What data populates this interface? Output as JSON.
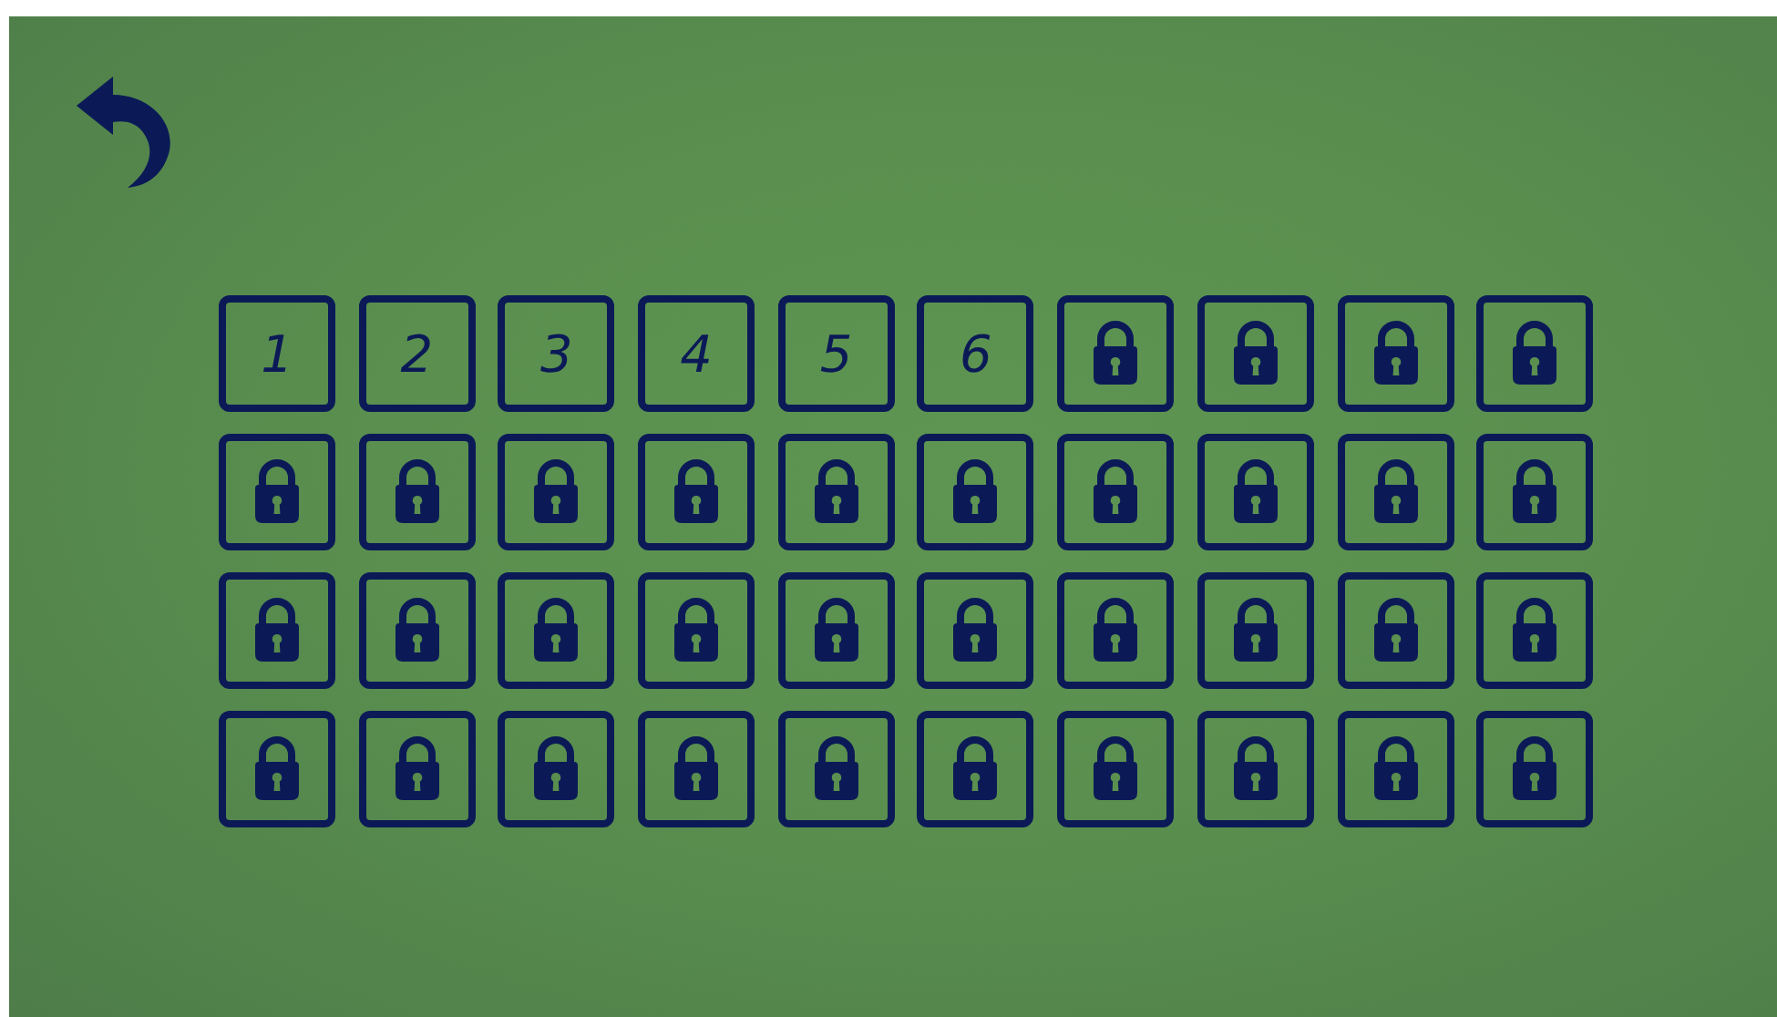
{
  "levels": [
    {
      "label": "1",
      "locked": false
    },
    {
      "label": "2",
      "locked": false
    },
    {
      "label": "3",
      "locked": false
    },
    {
      "label": "4",
      "locked": false
    },
    {
      "label": "5",
      "locked": false
    },
    {
      "label": "6",
      "locked": false
    },
    {
      "locked": true
    },
    {
      "locked": true
    },
    {
      "locked": true
    },
    {
      "locked": true
    },
    {
      "locked": true
    },
    {
      "locked": true
    },
    {
      "locked": true
    },
    {
      "locked": true
    },
    {
      "locked": true
    },
    {
      "locked": true
    },
    {
      "locked": true
    },
    {
      "locked": true
    },
    {
      "locked": true
    },
    {
      "locked": true
    },
    {
      "locked": true
    },
    {
      "locked": true
    },
    {
      "locked": true
    },
    {
      "locked": true
    },
    {
      "locked": true
    },
    {
      "locked": true
    },
    {
      "locked": true
    },
    {
      "locked": true
    },
    {
      "locked": true
    },
    {
      "locked": true
    },
    {
      "locked": true
    },
    {
      "locked": true
    },
    {
      "locked": true
    },
    {
      "locked": true
    },
    {
      "locked": true
    },
    {
      "locked": true
    },
    {
      "locked": true
    },
    {
      "locked": true
    },
    {
      "locked": true
    },
    {
      "locked": true
    }
  ]
}
